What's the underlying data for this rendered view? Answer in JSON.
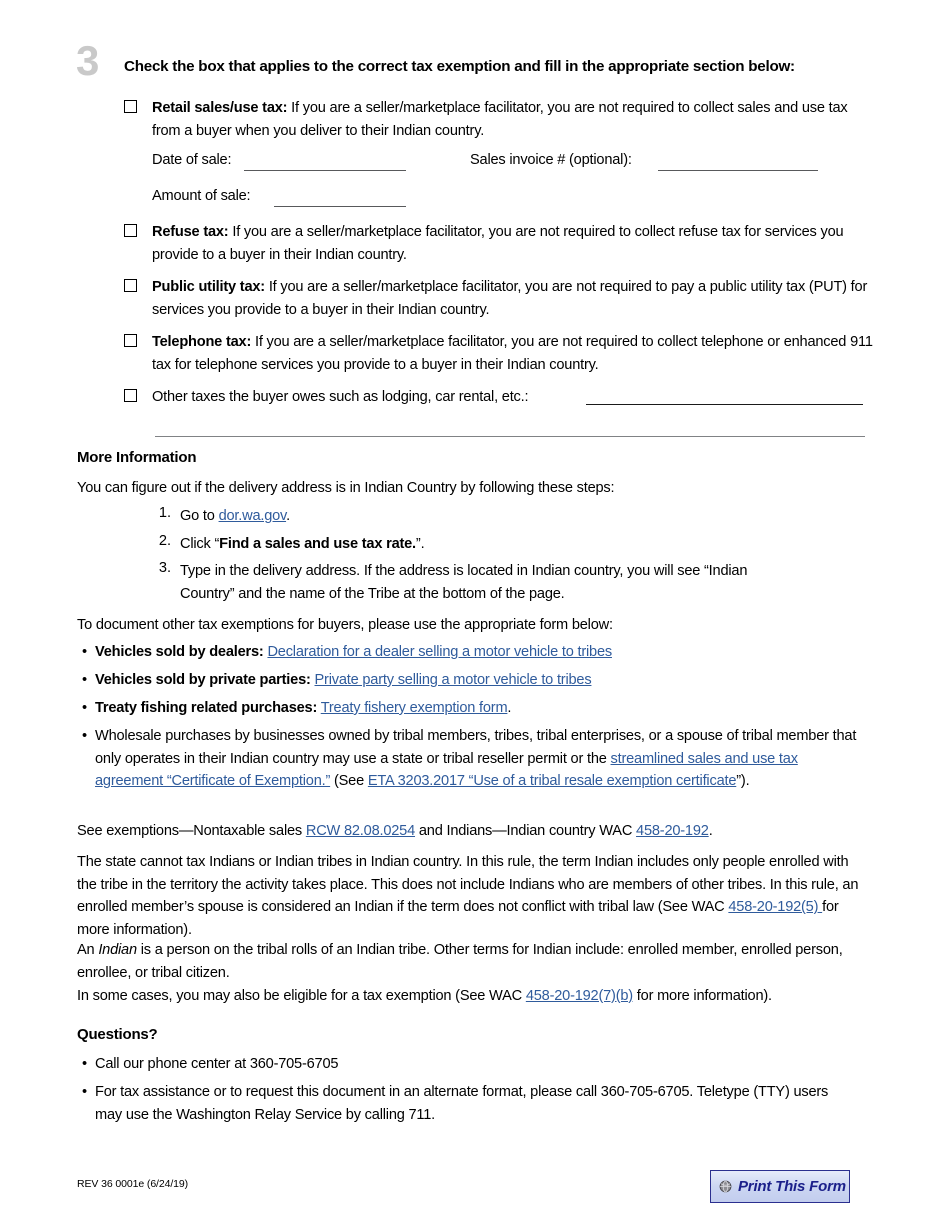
{
  "step": {
    "number": "3",
    "title": "Check the box that applies to the correct tax exemption and fill in the appropriate section below:"
  },
  "checkboxes": [
    {
      "label": "Retail sales/use tax:",
      "text": " If you are a seller/marketplace facilitator, you are not required to collect sales and use tax from a buyer when you deliver to their Indian country."
    },
    {
      "label": "Refuse tax:",
      "text": " If you are a seller/marketplace facilitator, you are not required to collect refuse tax for services you provide to a buyer in their Indian country."
    },
    {
      "label": "Public utility tax:",
      "text": " If you are a seller/marketplace facilitator, you are not required to pay a public utility tax (PUT) for services you provide to a buyer in their Indian country."
    },
    {
      "label": "Telephone tax:",
      "text": " If you are a seller/marketplace facilitator, you are not required to collect telephone or enhanced 911 tax for telephone services you provide to a buyer in their Indian country."
    },
    {
      "label": "",
      "text": "Other taxes the buyer owes such as lodging, car rental, etc.:"
    }
  ],
  "fields": {
    "date_of_sale_label": "Date of sale:",
    "date_of_sale_value": "",
    "sales_invoice_label": "Sales invoice # (optional):",
    "sales_invoice_value": "",
    "amount_of_sale_label": "Amount of sale:",
    "amount_of_sale_value": "",
    "other_taxes_value": ""
  },
  "more_information": {
    "heading": "More Information",
    "intro": "You can figure out if the delivery address is in Indian Country by following these steps:",
    "steps": [
      {
        "marker": "1.",
        "pre": "Go to ",
        "link": "dor.wa.gov",
        "post": "."
      },
      {
        "marker": "2.",
        "pre": "Click “",
        "bold": "Find a sales and use tax rate.",
        "post": "”."
      },
      {
        "marker": "3.",
        "pre": "Type in the delivery address. If the address is located in Indian country, you will see “Indian Country” and the name of the Tribe at the bottom of the page.",
        "post": ""
      }
    ],
    "forms_intro": "To document other tax exemptions for buyers, please use the appropriate form below:",
    "bullets": [
      {
        "bold": "Vehicles sold by dealers:",
        "pre": " ",
        "link": "Declaration for a dealer selling a motor vehicle to tribes",
        "post": ""
      },
      {
        "bold": "Vehicles sold by private parties:",
        "pre": " ",
        "link": "Private party selling a motor vehicle to tribes",
        "post": ""
      },
      {
        "bold": "Treaty fishing related purchases:",
        "pre": " ",
        "link": "Treaty fishery exemption form",
        "post": "."
      }
    ],
    "wholesale_bullet": {
      "part1": "Wholesale purchases by businesses owned by tribal members, tribes, tribal enterprises, or a spouse of tribal member that only operates in their Indian country may use a state or tribal reseller permit or the ",
      "link1": "streamlined sales and use tax agreement “Certificate of Exemption.”",
      "part2": " (See ",
      "link2": "ETA 3203.2017 “Use of a tribal resale exemption certificate",
      "part3": "”)."
    }
  },
  "paragraphs": {
    "see_exemptions": {
      "part1": "See exemptions—Nontaxable sales ",
      "link1": "RCW 82.08.0254",
      "part2": " and Indians—Indian country WAC ",
      "link2": "458-20-192",
      "part3": "."
    },
    "state_cannot_tax": {
      "part1": "The state cannot tax Indians or Indian tribes in Indian country. In this rule, the term Indian includes only people enrolled with the tribe in the territory the activity takes place. This does not include Indians who are members of other tribes. In this rule, an enrolled member’s spouse is considered an Indian if the term does not conflict with tribal law (See WAC ",
      "link1": "458-20-192(5) ",
      "part2": "for more information)."
    },
    "indian_definition": {
      "part1": "An ",
      "italic": "Indian",
      "part2": " is a person on the tribal rolls of an Indian tribe. Other terms for Indian include: enrolled member, enrolled person, enrollee, or tribal citizen."
    },
    "some_cases": {
      "part1": "In some cases, you may also be eligible for a tax exemption (See WAC ",
      "link1": "458-20-192(7)(b)",
      "part2": " for more information)."
    }
  },
  "questions": {
    "heading": "Questions?",
    "bullets": [
      "Call our phone center at 360-705-6705",
      "For tax assistance or to request this document in an alternate format, please call 360-705-6705. Teletype (TTY) users may use the Washington Relay Service by calling 711."
    ]
  },
  "footer": {
    "revision": "REV 36 0001e (6/24/19)",
    "print_button_label": "Print This Form"
  },
  "colors": {
    "link": "#2f5b9c",
    "step_number": "#c9c9c9",
    "button_border": "#2b2f8f",
    "button_text": "#1b1f8a"
  }
}
